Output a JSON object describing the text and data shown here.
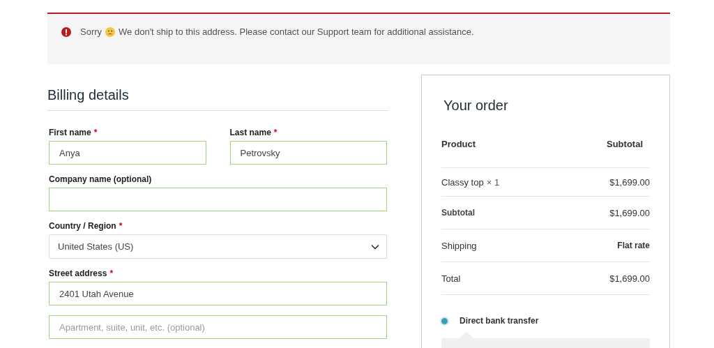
{
  "notice": {
    "text_before": "Sorry",
    "text": "We don't ship to this address. Please contact our Support team for additional assistance."
  },
  "billing": {
    "title": "Billing details",
    "rows": [
      [
        {
          "kind": "input",
          "label": "First name",
          "required_mark": "*",
          "value": "Anya"
        },
        {
          "kind": "input",
          "label": "Last name",
          "required_mark": "*",
          "value": "Petrovsky"
        }
      ],
      [
        {
          "kind": "input",
          "label": "Company name (optional)"
        }
      ],
      [
        {
          "kind": "select",
          "label": "Country / Region",
          "required_mark": "*",
          "value": "United States (US)"
        }
      ],
      [
        {
          "kind": "input",
          "label": "Street address",
          "required_mark": "*",
          "value": "2401 Utah Avenue"
        }
      ],
      [
        {
          "kind": "input",
          "placeholder": "Apartment, suite, unit, etc. (optional)"
        }
      ]
    ]
  },
  "order": {
    "title": "Your order",
    "rows": [
      {
        "kind": "header",
        "label": "Product",
        "value": "Subtotal"
      },
      {
        "kind": "item",
        "label": "Classy top",
        "quantity": "× 1",
        "value": "$1,699.00"
      },
      {
        "kind": "subtotal",
        "label": "Subtotal",
        "value": "$1,699.00"
      },
      {
        "kind": "shipping",
        "label": "Shipping",
        "value": "Flat rate"
      },
      {
        "kind": "total",
        "label": "Total",
        "value": "$1,699.00"
      }
    ],
    "payment_methods": [
      {
        "label": "Direct bank transfer",
        "selected": true
      }
    ]
  }
}
